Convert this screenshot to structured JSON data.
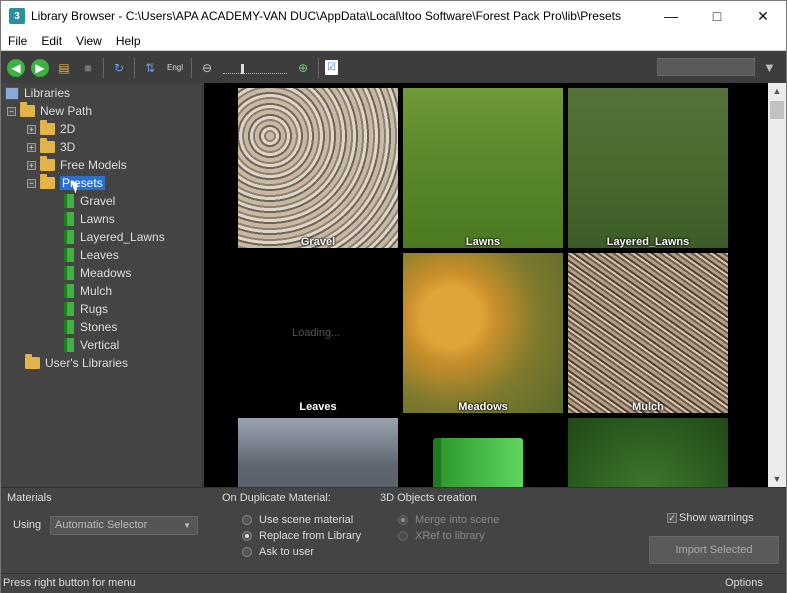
{
  "window": {
    "title": "Library Browser - C:\\Users\\APA ACADEMY-VAN DUC\\AppData\\Local\\Itoo Software\\Forest Pack Pro\\lib\\Presets",
    "app_icon": "3"
  },
  "menu": [
    "File",
    "Edit",
    "View",
    "Help"
  ],
  "toolbar": {
    "lang_label": "Engl",
    "search_value": ""
  },
  "tree": {
    "root": "Libraries",
    "new_path": "New Path",
    "folders": [
      "2D",
      "3D",
      "Free Models",
      "Presets"
    ],
    "presets_children": [
      "Gravel",
      "Lawns",
      "Layered_Lawns",
      "Leaves",
      "Meadows",
      "Mulch",
      "Rugs",
      "Stones",
      "Vertical"
    ],
    "user_libraries": "User's Libraries"
  },
  "tiles": [
    {
      "label": "Gravel"
    },
    {
      "label": "Lawns"
    },
    {
      "label": "Layered_Lawns"
    },
    {
      "label": "Leaves",
      "loading": "Loading..."
    },
    {
      "label": "Meadows"
    },
    {
      "label": "Mulch"
    },
    {
      "label": ""
    },
    {
      "label": ""
    },
    {
      "label": ""
    }
  ],
  "bottom": {
    "materials_title": "Materials",
    "using_label": "Using",
    "using_value": "Automatic Selector",
    "duplicate_title": "On Duplicate Material:",
    "dup_options": [
      "Use scene material",
      "Replace from Library",
      "Ask to user"
    ],
    "objects_title": "3D Objects creation",
    "obj_options": [
      "Merge into scene",
      "XRef to library"
    ],
    "show_warnings": "Show warnings",
    "import_button": "Import Selected"
  },
  "status": {
    "left": "Press right button for menu",
    "right": "Options"
  }
}
